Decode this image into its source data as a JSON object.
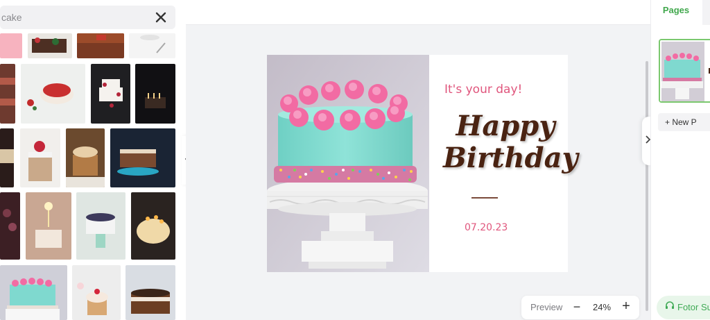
{
  "search": {
    "value": "cake",
    "clear_icon": "close-icon"
  },
  "canvas": {
    "tagline": "It's your day!",
    "headline_line1": "Happy",
    "headline_line2": "Birthday",
    "date": "07.20.23"
  },
  "zoom": {
    "preview_label": "Preview",
    "minus_label": "−",
    "level": "24%",
    "plus_label": "+"
  },
  "right_panel": {
    "tab_pages_label": "Pages",
    "new_page_label": "+ New P",
    "support_label": "Fotor Su"
  },
  "colors": {
    "accent_green": "#41a84d",
    "tagline_pink": "#e0567d",
    "headline_brown": "#4a2312",
    "cake_mint": "#7fd9cf",
    "frosting_pink": "#f26ba3"
  }
}
